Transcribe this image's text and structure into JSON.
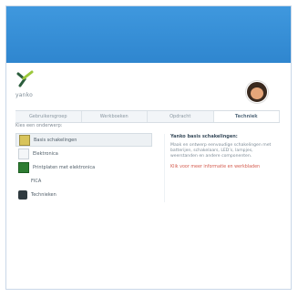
{
  "header": {
    "brand_text": "yanko"
  },
  "tabs": [
    {
      "label": "Gebruikersgroep"
    },
    {
      "label": "Werkboeken"
    },
    {
      "label": "Opdracht"
    },
    {
      "label": "Techniek",
      "active": true
    }
  ],
  "panel": {
    "title": "Kies een onderwerp:",
    "menu": [
      {
        "label": "Basis schakelingen",
        "icon": "battery-icon",
        "active": true
      },
      {
        "label": "Elektronica",
        "icon": "electronics-icon"
      },
      {
        "label": "Printplaten met elektronica",
        "icon": "circuit-board-icon"
      },
      {
        "label": "FICA",
        "icon": "fica-icon"
      },
      {
        "label": "Technieken",
        "icon": "tools-icon"
      }
    ],
    "detail": {
      "title": "Yanko basis schakelingen:",
      "body": "Maak en ontwerp eenvoudige schakelingen met batterijen, schakelaars, LED’s, lampjes, weerstanden en andere componenten.",
      "link": "Klik voor meer informatie en werkbladen"
    }
  },
  "colors": {
    "topbar": "#2f86cf",
    "active_tab_text": "#5a6f80",
    "link": "#d35b4e"
  }
}
